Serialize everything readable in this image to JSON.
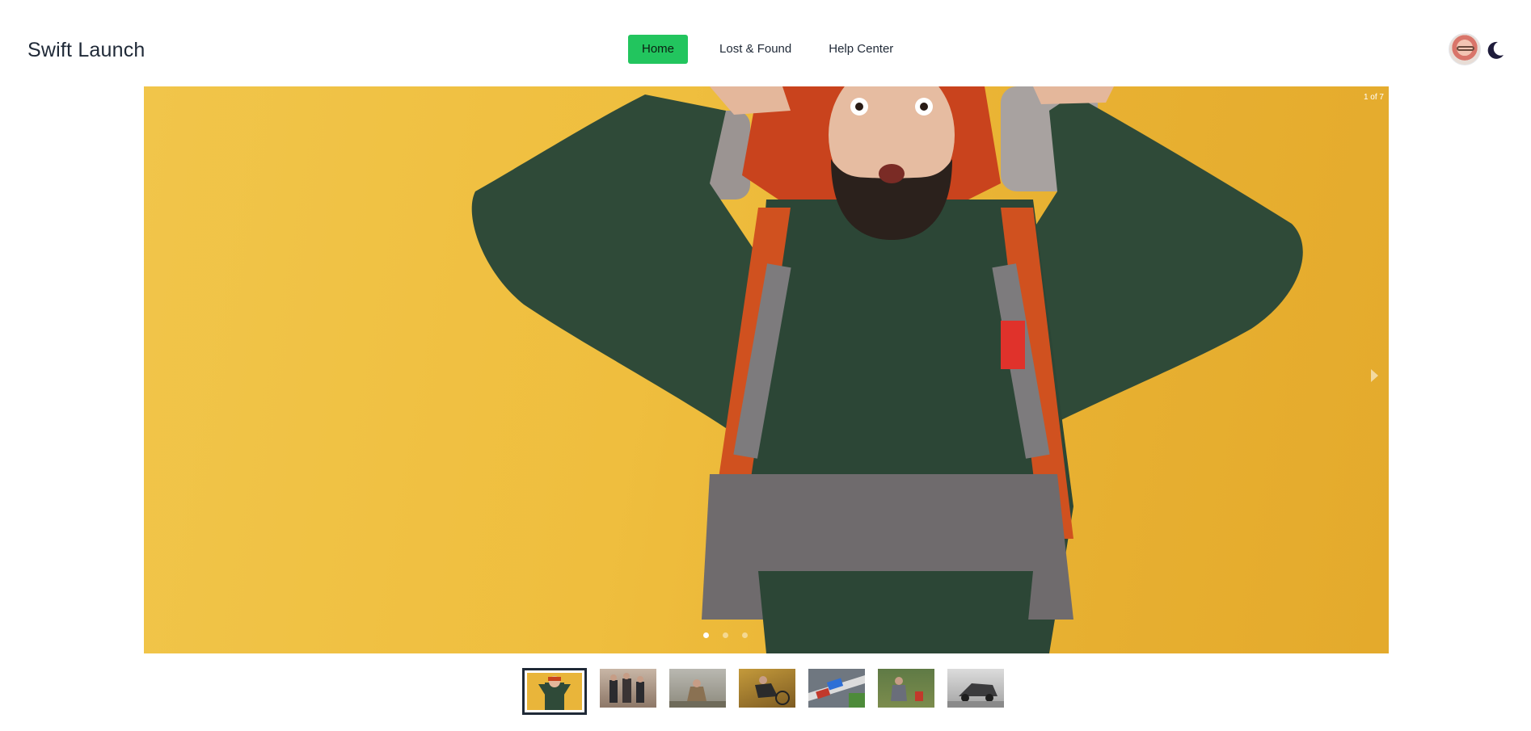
{
  "header": {
    "brand": "Swift Launch",
    "nav": [
      {
        "label": "Home",
        "active": true
      },
      {
        "label": "Lost & Found",
        "active": false
      },
      {
        "label": "Help Center",
        "active": false
      }
    ],
    "avatar_icon": "user-avatar",
    "theme_toggle_icon": "moon-icon"
  },
  "carousel": {
    "counter": "1 of 7",
    "current_slide": 1,
    "total_slides": 7,
    "next_icon": "chevron-right-icon",
    "slide_description_icon": "hiker-with-backpack-image"
  },
  "thumbnails": [
    {
      "name": "thumb-hiker-yellow",
      "active": true
    },
    {
      "name": "thumb-group-forest",
      "active": false
    },
    {
      "name": "thumb-person-crouching",
      "active": false
    },
    {
      "name": "thumb-injured-cyclist",
      "active": false
    },
    {
      "name": "thumb-car-accident",
      "active": false
    },
    {
      "name": "thumb-person-grass",
      "active": false
    },
    {
      "name": "thumb-overturned-car",
      "active": false
    }
  ],
  "colors": {
    "accent": "#22c55e",
    "slide_background": "#efbe3e",
    "text": "#1f2937"
  }
}
